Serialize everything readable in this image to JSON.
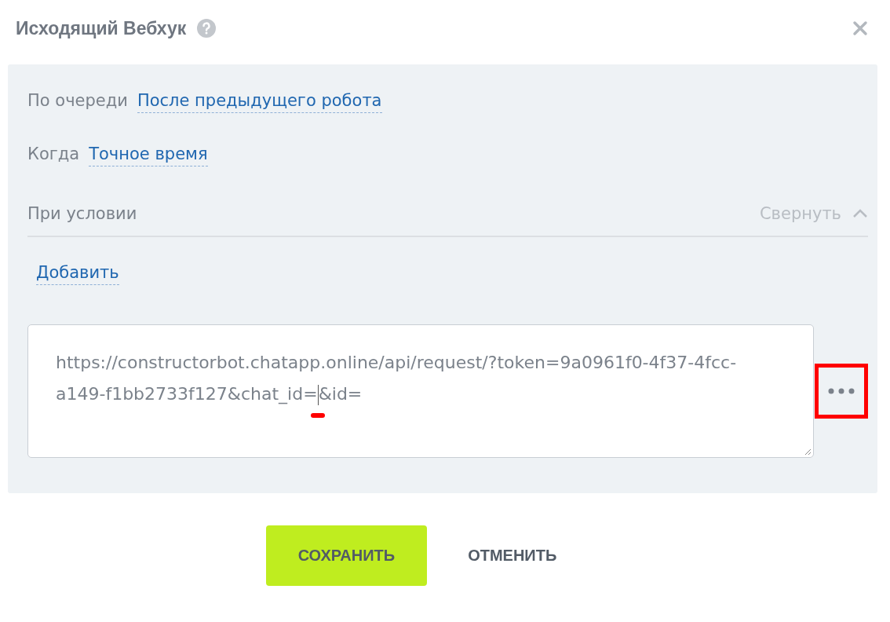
{
  "window": {
    "title": "Исходящий Вебхук"
  },
  "settings": [
    {
      "label": "По очереди",
      "value": "После предыдущего робота"
    },
    {
      "label": "Когда",
      "value": "Точное время"
    }
  ],
  "condition": {
    "label": "При условии",
    "toggle": "Свернуть",
    "expanded": true,
    "add_link": "Добавить"
  },
  "url_field": {
    "text_before_cursor": "https://constructorbot.chatapp.online/api/request/?token=9a0961f0-4f37-4fcc-a149-f1bb2733f127&chat_id=",
    "text_after_cursor": "&id=",
    "highlighted": true
  },
  "buttons": [
    {
      "label": "СОХРАНИТЬ",
      "kind": "primary"
    },
    {
      "label": "ОТМЕНИТЬ",
      "kind": "link"
    }
  ]
}
